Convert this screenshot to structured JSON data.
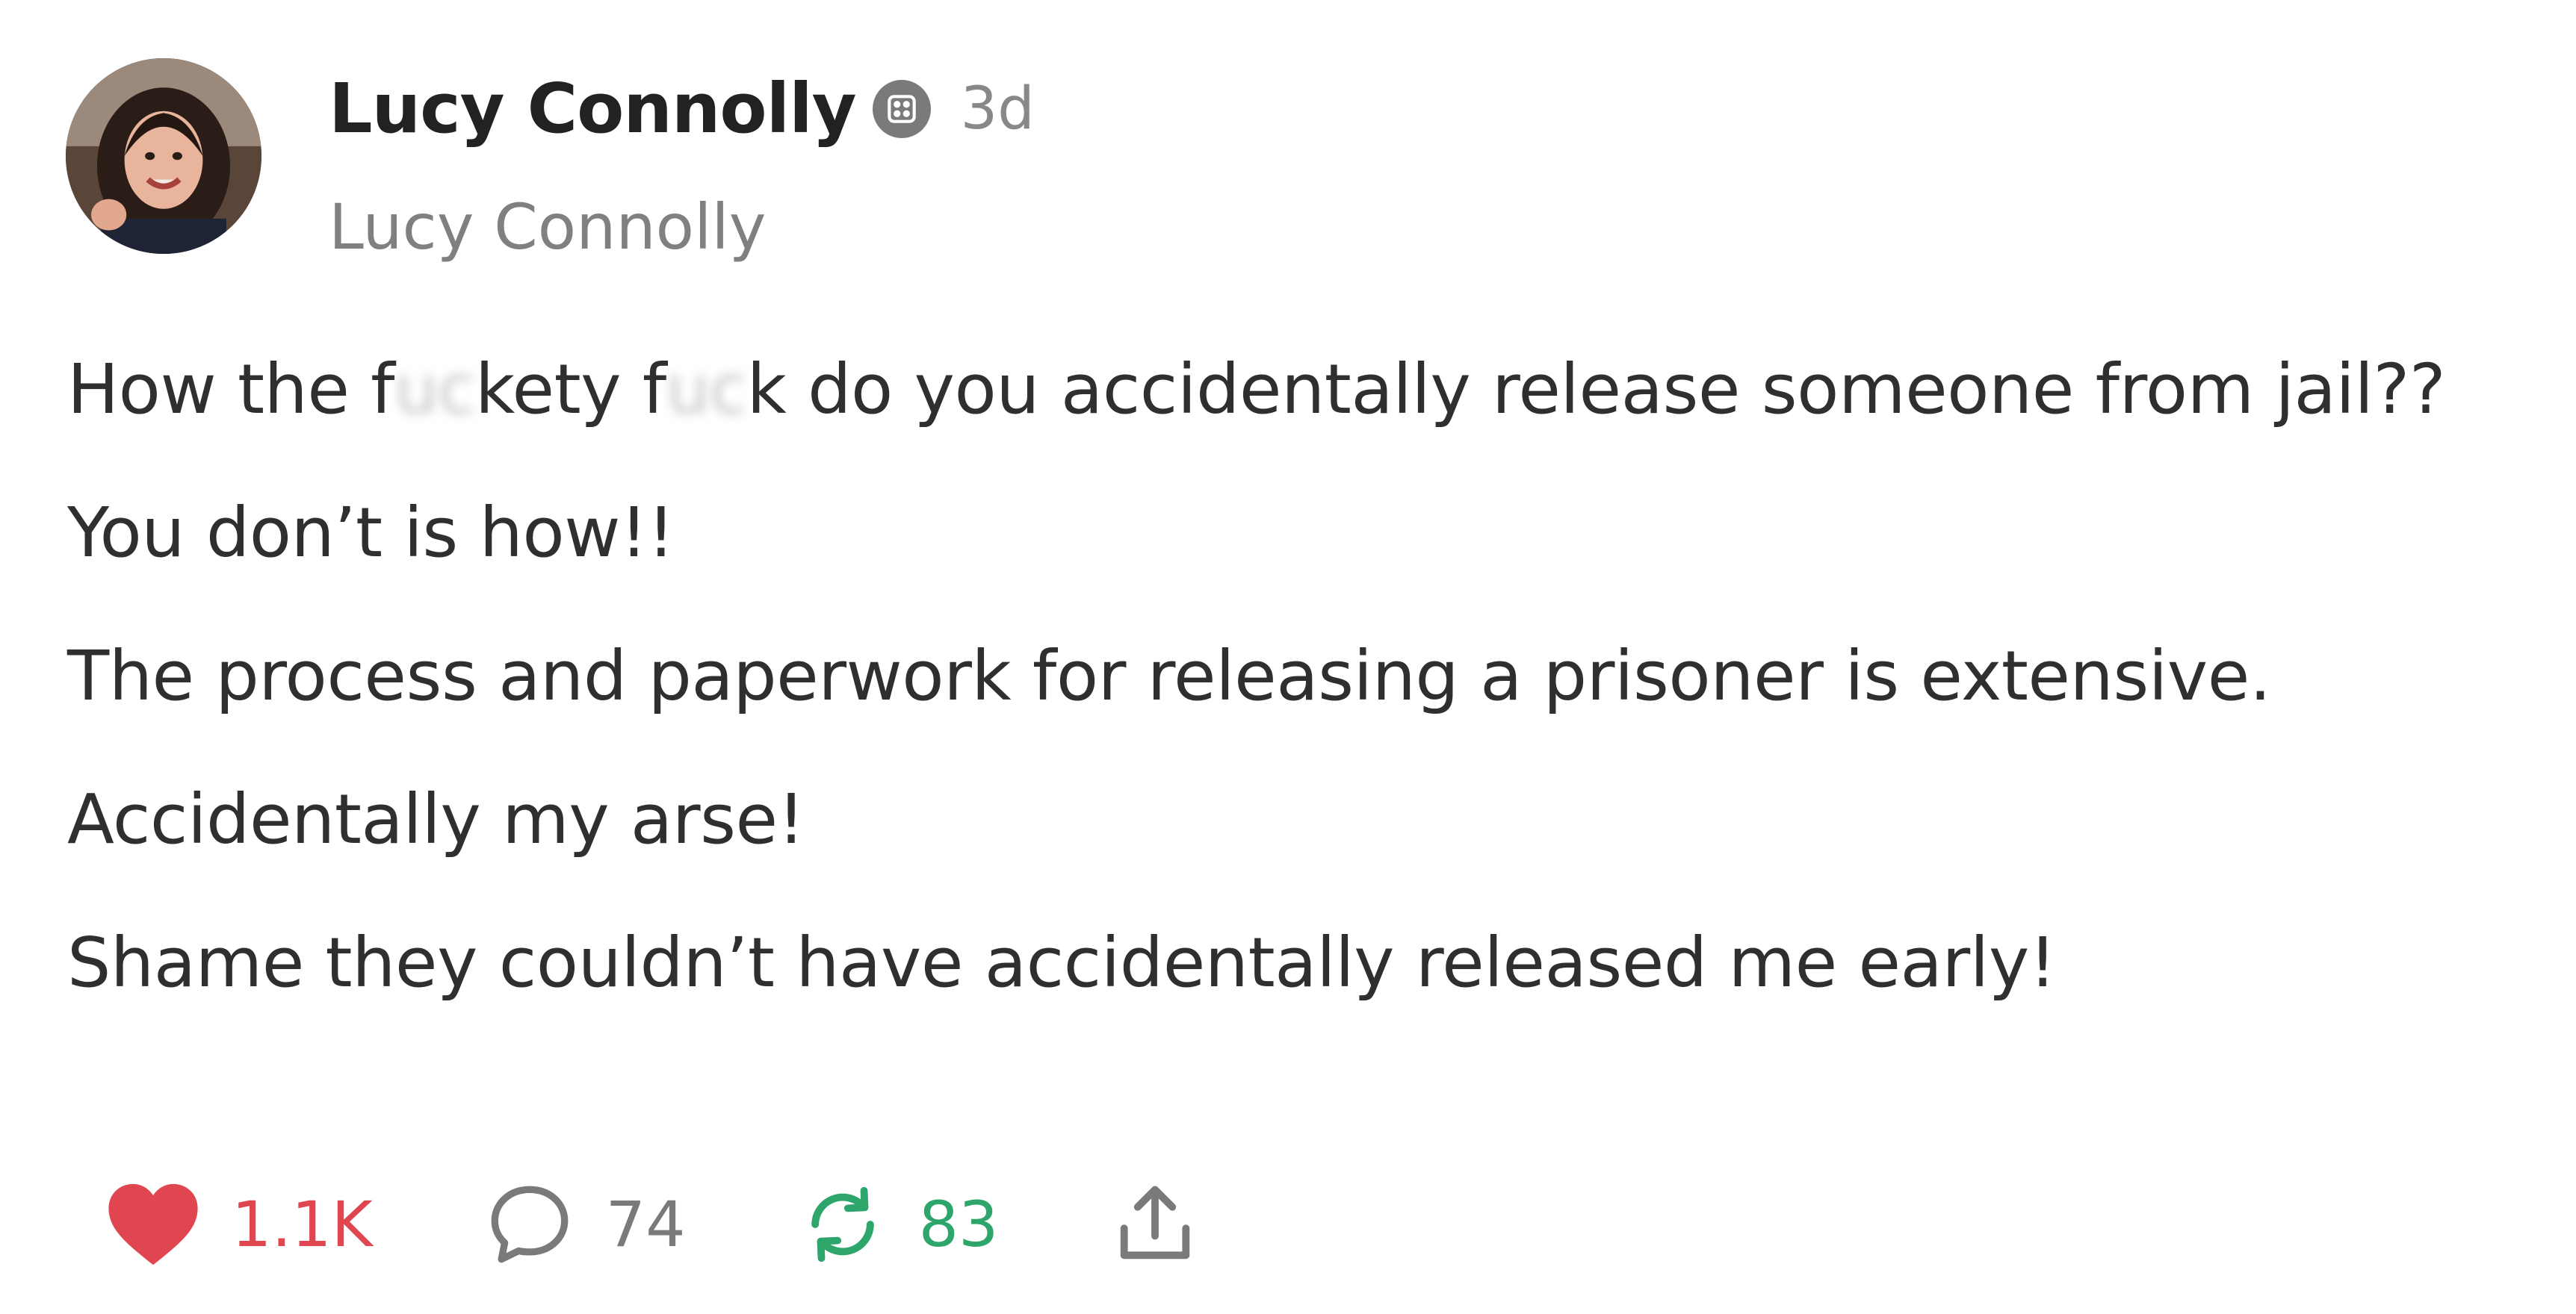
{
  "post": {
    "author": {
      "display_name": "Lucy Connolly",
      "handle": "Lucy Connolly",
      "verified_icon": "verified-badge-icon"
    },
    "timestamp": "3d",
    "lines": [
      {
        "before": "How the f",
        "blur": "uc",
        "middle": "kety f",
        "blur2": "uc",
        "after": "k do you accidentally release someone from jail??"
      },
      {
        "text": "You don’t is how!!"
      },
      {
        "text": "The process and paperwork for releasing a prisoner is extensive."
      },
      {
        "text": "Accidentally my arse!"
      },
      {
        "text": "Shame they couldn’t have accidentally released me early!"
      }
    ],
    "actions": {
      "likes": "1.1K",
      "replies": "74",
      "reposts": "83"
    },
    "colors": {
      "like": "#e0464f",
      "repost": "#2ea56b",
      "muted": "#7a7a7a"
    },
    "icons": [
      "heart-icon",
      "comment-icon",
      "repost-icon",
      "share-icon"
    ]
  }
}
